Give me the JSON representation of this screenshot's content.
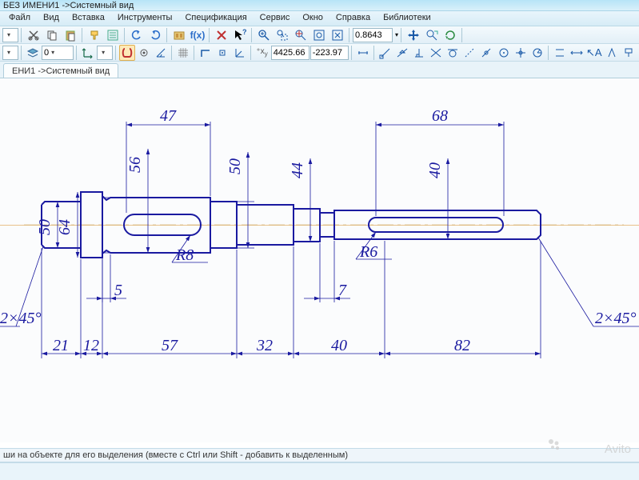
{
  "title": "БЕЗ ИМЕНИ1 ->Системный вид",
  "menu": [
    {
      "label": "Файл",
      "mn": "Ф"
    },
    {
      "label": "Вид",
      "mn": "В"
    },
    {
      "label": "Вставка",
      "mn": "В"
    },
    {
      "label": "Инструменты",
      "mn": "И"
    },
    {
      "label": "Спецификация",
      "mn": "С"
    },
    {
      "label": "Сервис",
      "mn": "е"
    },
    {
      "label": "Окно",
      "mn": "О"
    },
    {
      "label": "Справка",
      "mn": "п"
    },
    {
      "label": "Библиотеки",
      "mn": "Б"
    }
  ],
  "toolbar1": {
    "zoom_value": "0.8643"
  },
  "toolbar2": {
    "layer": "0",
    "coord_x": "4425.66",
    "coord_y": "-223.97"
  },
  "tab": "ЕНИ1 ->Системный вид",
  "status": "ши на объекте для его выделения (вместе с Ctrl или Shift - добавить к выделенным)",
  "watermark": "Avito",
  "dims": {
    "top_left": "47",
    "top_right": "68",
    "d56": "56",
    "d50r": "50",
    "d44": "44",
    "d40": "40",
    "d50l": "50",
    "d64": "64",
    "r8": "R8",
    "r6": "R6",
    "b5": "5",
    "b7": "7",
    "ch_l": "2×45°",
    "ch_r": "2×45°",
    "l21": "21",
    "l12": "12",
    "l57": "57",
    "l32": "32",
    "l40": "40",
    "l82": "82"
  }
}
